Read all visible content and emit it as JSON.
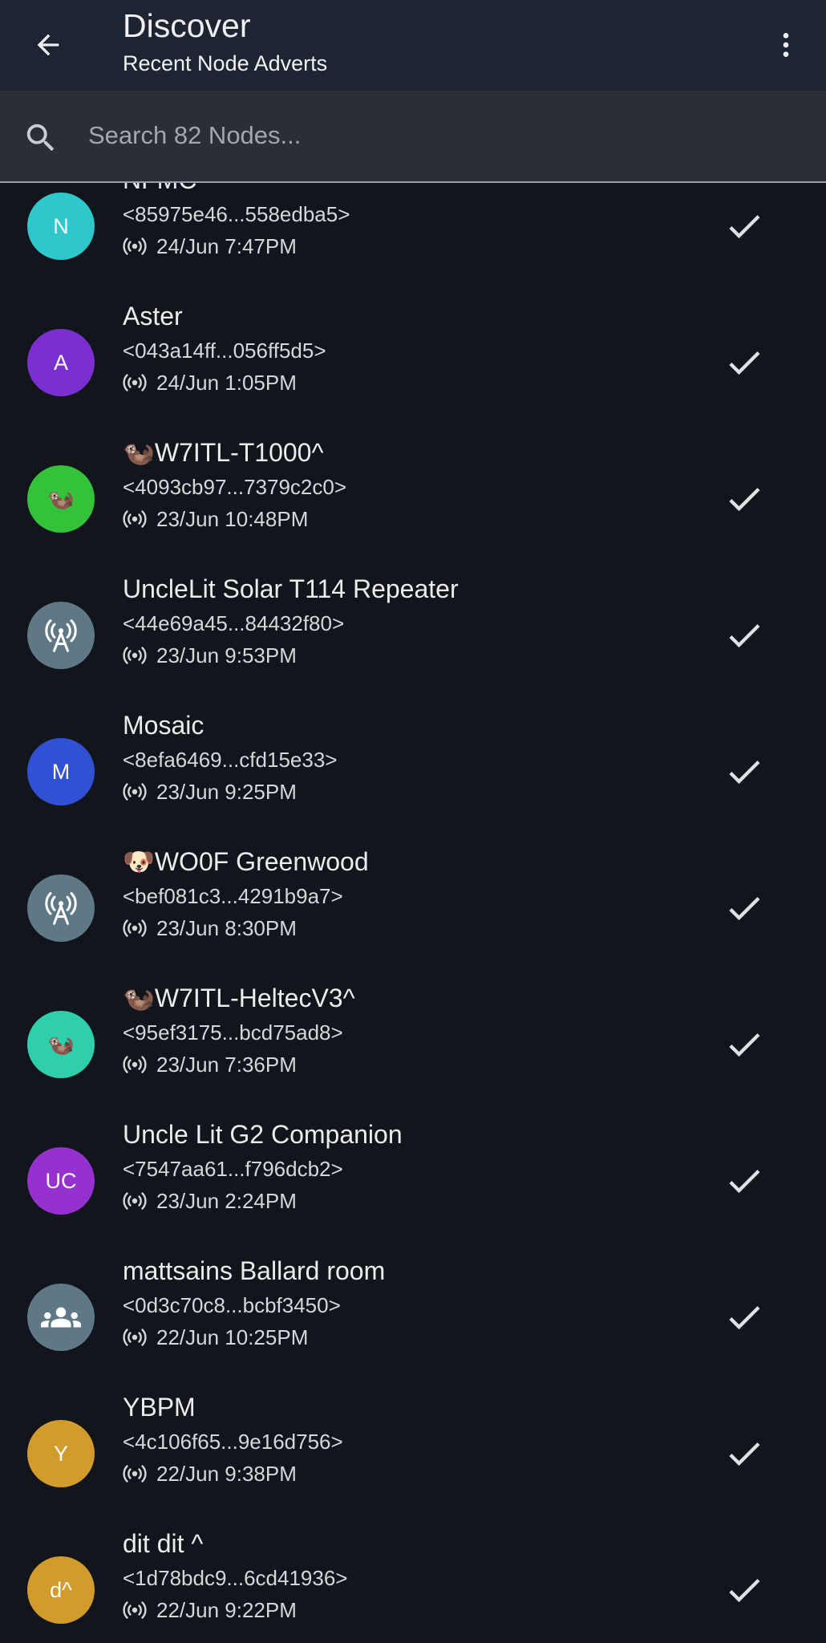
{
  "app_bar": {
    "title": "Discover",
    "subtitle": "Recent Node Adverts",
    "back_icon": "arrow-back-icon",
    "menu_icon": "more-vert-icon"
  },
  "search": {
    "placeholder": "Search 82 Nodes...",
    "value": ""
  },
  "nodes": [
    {
      "avatar_text": "N",
      "avatar_icon": "",
      "avatar_color": "#2ec7cb",
      "name": "NFMC^",
      "key": "<85975e46...558edba5>",
      "last_advert": "24/Jun 7:47PM"
    },
    {
      "avatar_text": "A",
      "avatar_icon": "",
      "avatar_color": "#7b2fd0",
      "name": "Aster",
      "key": "<043a14ff...056ff5d5>",
      "last_advert": "24/Jun 1:05PM"
    },
    {
      "avatar_text": "🦦",
      "avatar_icon": "",
      "avatar_color": "#33c23a",
      "name": "🦦W7ITL-T1000^",
      "key": "<4093cb97...7379c2c0>",
      "last_advert": "23/Jun 10:48PM"
    },
    {
      "avatar_text": "",
      "avatar_icon": "repeater-antenna-icon",
      "avatar_color": "#5f7886",
      "name": "UncleLit Solar T114 Repeater",
      "key": "<44e69a45...84432f80>",
      "last_advert": "23/Jun 9:53PM"
    },
    {
      "avatar_text": "M",
      "avatar_icon": "",
      "avatar_color": "#3151d4",
      "name": "Mosaic",
      "key": "<8efa6469...cfd15e33>",
      "last_advert": "23/Jun 9:25PM"
    },
    {
      "avatar_text": "",
      "avatar_icon": "repeater-antenna-icon",
      "avatar_color": "#5f7886",
      "name": "🐶WO0F Greenwood",
      "key": "<bef081c3...4291b9a7>",
      "last_advert": "23/Jun 8:30PM"
    },
    {
      "avatar_text": "🦦",
      "avatar_icon": "",
      "avatar_color": "#2fcfae",
      "name": "🦦W7ITL-HeltecV3^",
      "key": "<95ef3175...bcd75ad8>",
      "last_advert": "23/Jun 7:36PM"
    },
    {
      "avatar_text": "UC",
      "avatar_icon": "",
      "avatar_color": "#9631cf",
      "name": "Uncle Lit G2 Companion",
      "key": "<7547aa61...f796dcb2>",
      "last_advert": "23/Jun 2:24PM"
    },
    {
      "avatar_text": "",
      "avatar_icon": "group-room-icon",
      "avatar_color": "#5f7886",
      "name": "mattsains Ballard room",
      "key": "<0d3c70c8...bcbf3450>",
      "last_advert": "22/Jun 10:25PM"
    },
    {
      "avatar_text": "Y",
      "avatar_icon": "",
      "avatar_color": "#d39b2b",
      "name": "YBPM",
      "key": "<4c106f65...9e16d756>",
      "last_advert": "22/Jun 9:38PM"
    },
    {
      "avatar_text": "d^",
      "avatar_icon": "",
      "avatar_color": "#d39b2b",
      "name": "dit dit ^",
      "key": "<1d78bdc9...6cd41936>",
      "last_advert": "22/Jun 9:22PM"
    }
  ],
  "colors": {
    "app_bar_bg": "#1d2533",
    "search_bg": "#2b2e34",
    "page_bg": "#12151c",
    "icon": "#e8e9ec"
  }
}
